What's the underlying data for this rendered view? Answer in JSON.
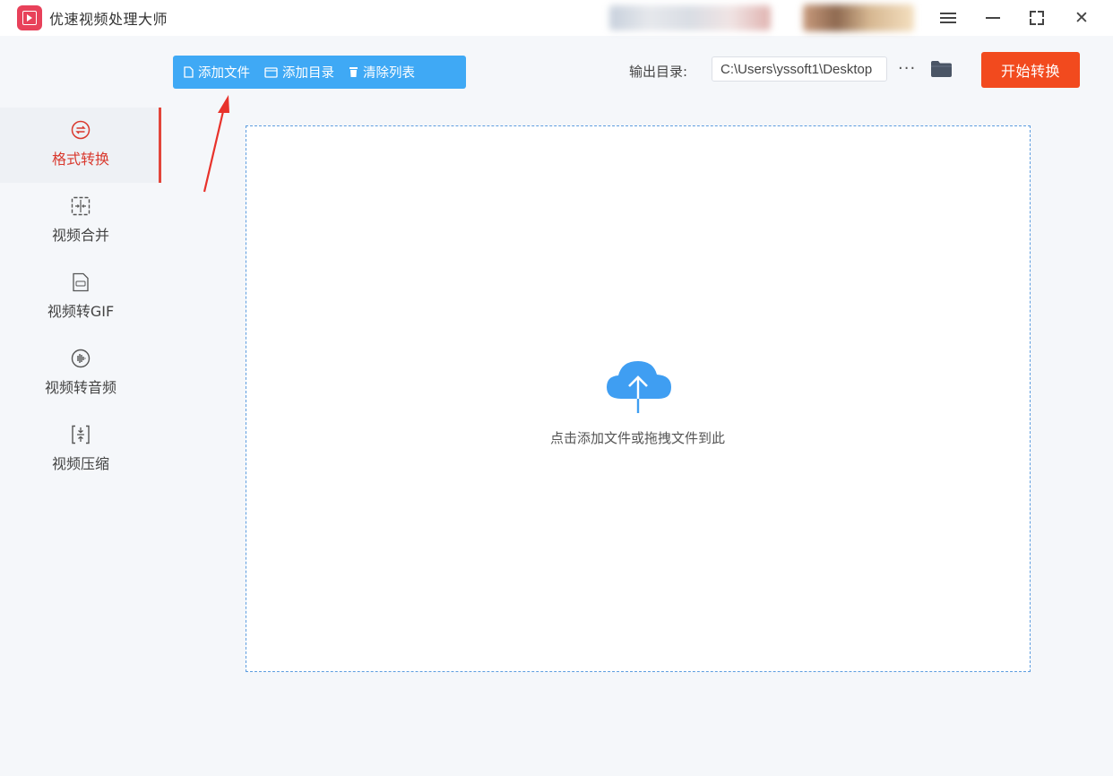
{
  "app": {
    "title": "优速视频处理大师",
    "accent": "#e2453a",
    "primary_blue": "#3fa9f5",
    "start_color": "#f24a1e"
  },
  "window_controls": {
    "menu_icon": "hamburger-menu-icon",
    "minimize_icon": "minimize-icon",
    "maximize_icon": "maximize-icon",
    "close_icon": "close-icon",
    "close_glyph": "✕"
  },
  "sidebar": {
    "items": [
      {
        "label": "格式转换",
        "icon": "format-convert-icon",
        "active": true
      },
      {
        "label": "视频合并",
        "icon": "merge-icon",
        "active": false
      },
      {
        "label": "视频转GIF",
        "icon": "gif-icon",
        "active": false
      },
      {
        "label": "视频转音频",
        "icon": "audio-icon",
        "active": false
      },
      {
        "label": "视频压缩",
        "icon": "compress-icon",
        "active": false
      }
    ]
  },
  "toolbar": {
    "add_file": "添加文件",
    "add_folder": "添加目录",
    "clear_list": "清除列表"
  },
  "output": {
    "label": "输出目录:",
    "path": "C:\\Users\\yssoft1\\Desktop",
    "more": "···"
  },
  "start_button": "开始转换",
  "dropzone": {
    "hint": "点击添加文件或拖拽文件到此"
  }
}
